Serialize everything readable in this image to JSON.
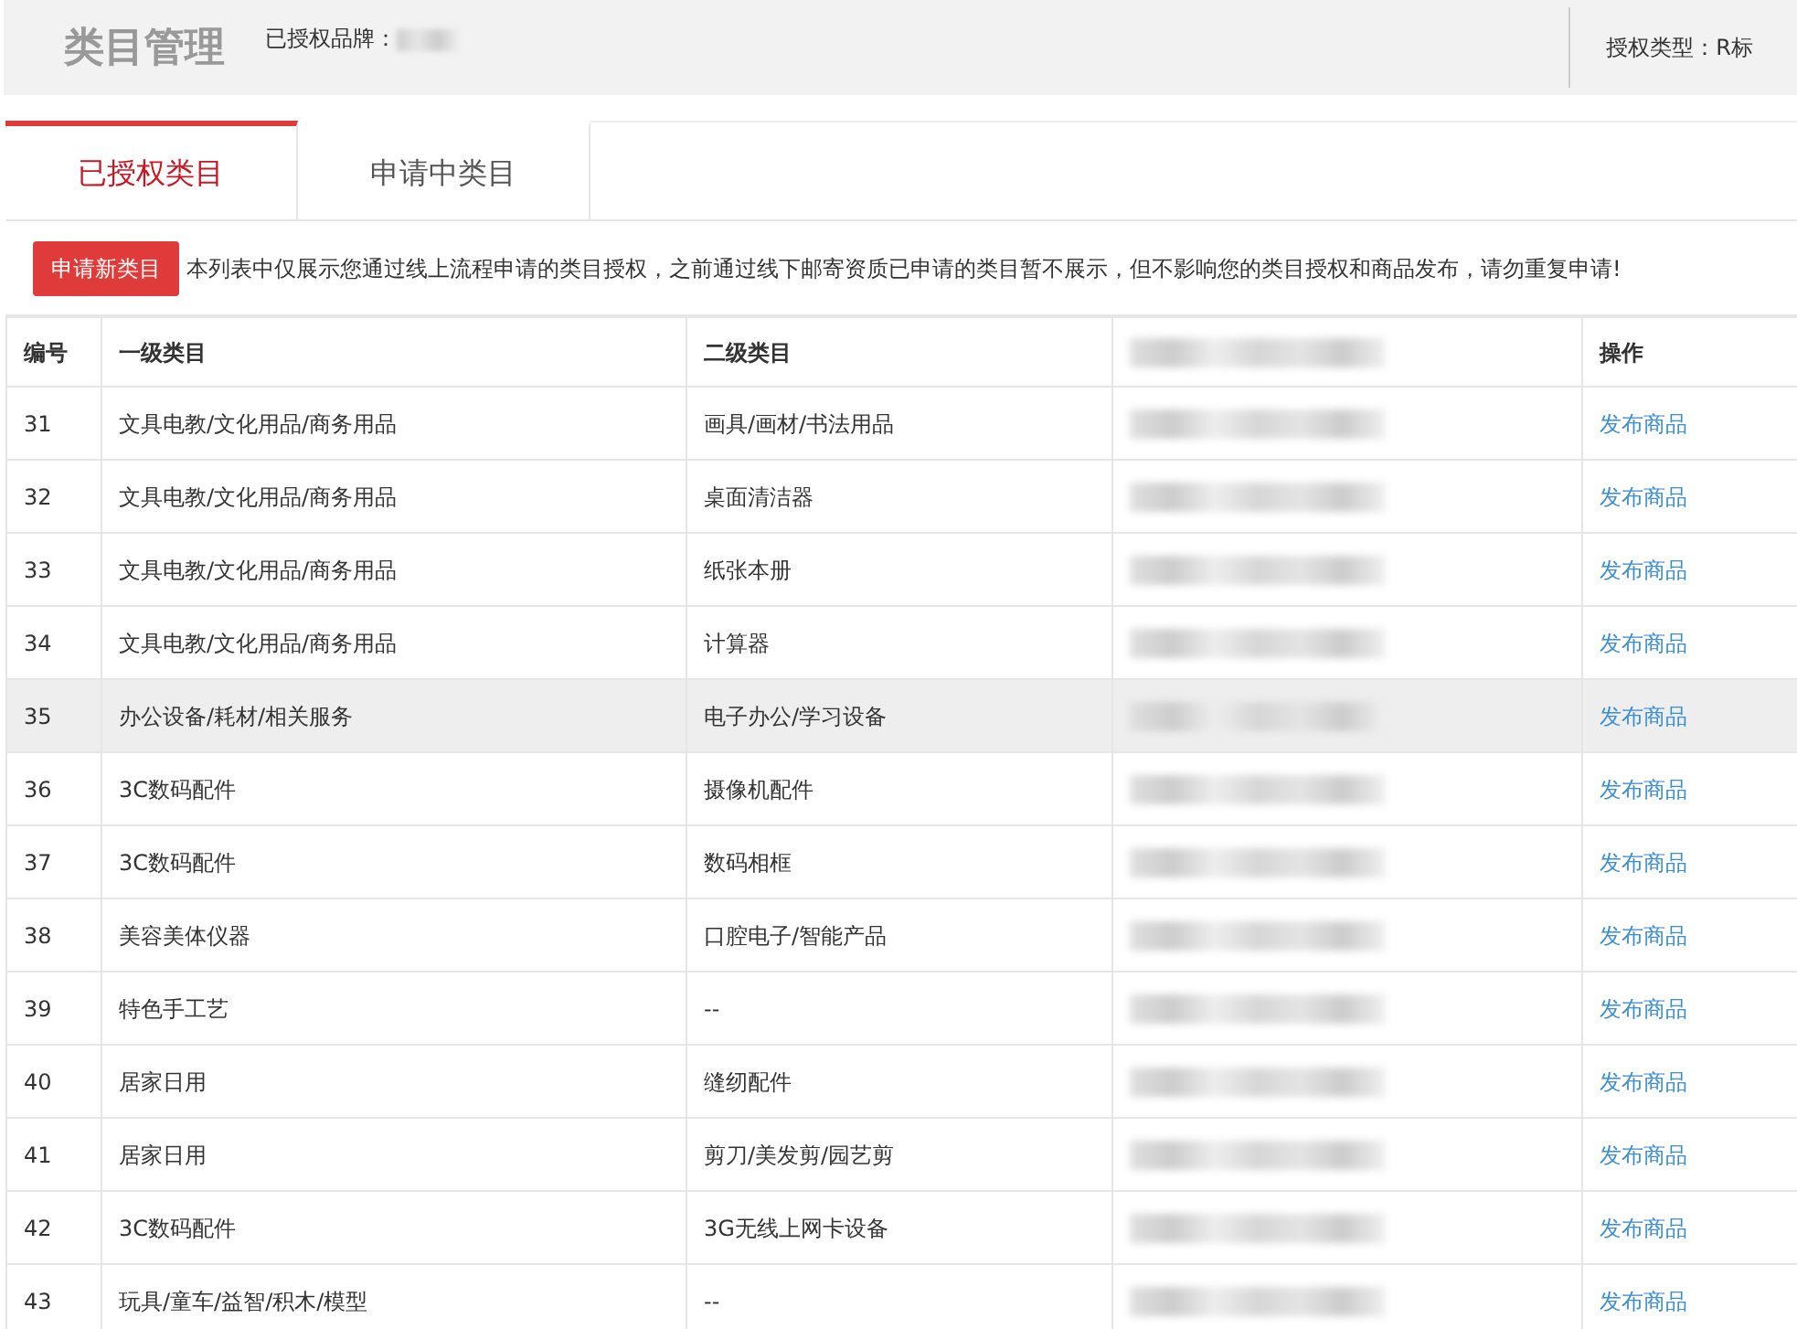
{
  "header": {
    "title": "类目管理",
    "brand_label": "已授权品牌：",
    "auth_type": "授权类型：R标"
  },
  "tabs": [
    {
      "label": "已授权类目",
      "selected": true
    },
    {
      "label": "申请中类目",
      "selected": false
    }
  ],
  "notice": {
    "button": "申请新类目",
    "text": "本列表中仅展示您通过线上流程申请的类目授权，之前通过线下邮寄资质已申请的类目暂不展示，但不影响您的类目授权和商品发布，请勿重复申请!"
  },
  "table": {
    "columns": [
      "编号",
      "一级类目",
      "二级类目",
      "",
      "操作"
    ],
    "rows": [
      {
        "id": "31",
        "level1": "文具电教/文化用品/商务用品",
        "level2": "画具/画材/书法用品",
        "action": "发布商品",
        "highlighted": false
      },
      {
        "id": "32",
        "level1": "文具电教/文化用品/商务用品",
        "level2": "桌面清洁器",
        "action": "发布商品",
        "highlighted": false
      },
      {
        "id": "33",
        "level1": "文具电教/文化用品/商务用品",
        "level2": "纸张本册",
        "action": "发布商品",
        "highlighted": false
      },
      {
        "id": "34",
        "level1": "文具电教/文化用品/商务用品",
        "level2": "计算器",
        "action": "发布商品",
        "highlighted": false
      },
      {
        "id": "35",
        "level1": "办公设备/耗材/相关服务",
        "level2": "电子办公/学习设备",
        "action": "发布商品",
        "highlighted": true
      },
      {
        "id": "36",
        "level1": "3C数码配件",
        "level2": "摄像机配件",
        "action": "发布商品",
        "highlighted": false
      },
      {
        "id": "37",
        "level1": "3C数码配件",
        "level2": "数码相框",
        "action": "发布商品",
        "highlighted": false
      },
      {
        "id": "38",
        "level1": "美容美体仪器",
        "level2": "口腔电子/智能产品",
        "action": "发布商品",
        "highlighted": false
      },
      {
        "id": "39",
        "level1": "特色手工艺",
        "level2": "--",
        "action": "发布商品",
        "highlighted": false
      },
      {
        "id": "40",
        "level1": "居家日用",
        "level2": "缝纫配件",
        "action": "发布商品",
        "highlighted": false
      },
      {
        "id": "41",
        "level1": "居家日用",
        "level2": "剪刀/美发剪/园艺剪",
        "action": "发布商品",
        "highlighted": false
      },
      {
        "id": "42",
        "level1": "3C数码配件",
        "level2": "3G无线上网卡设备",
        "action": "发布商品",
        "highlighted": false
      },
      {
        "id": "43",
        "level1": "玩具/童车/益智/积木/模型",
        "level2": "--",
        "action": "发布商品",
        "highlighted": false
      }
    ]
  }
}
